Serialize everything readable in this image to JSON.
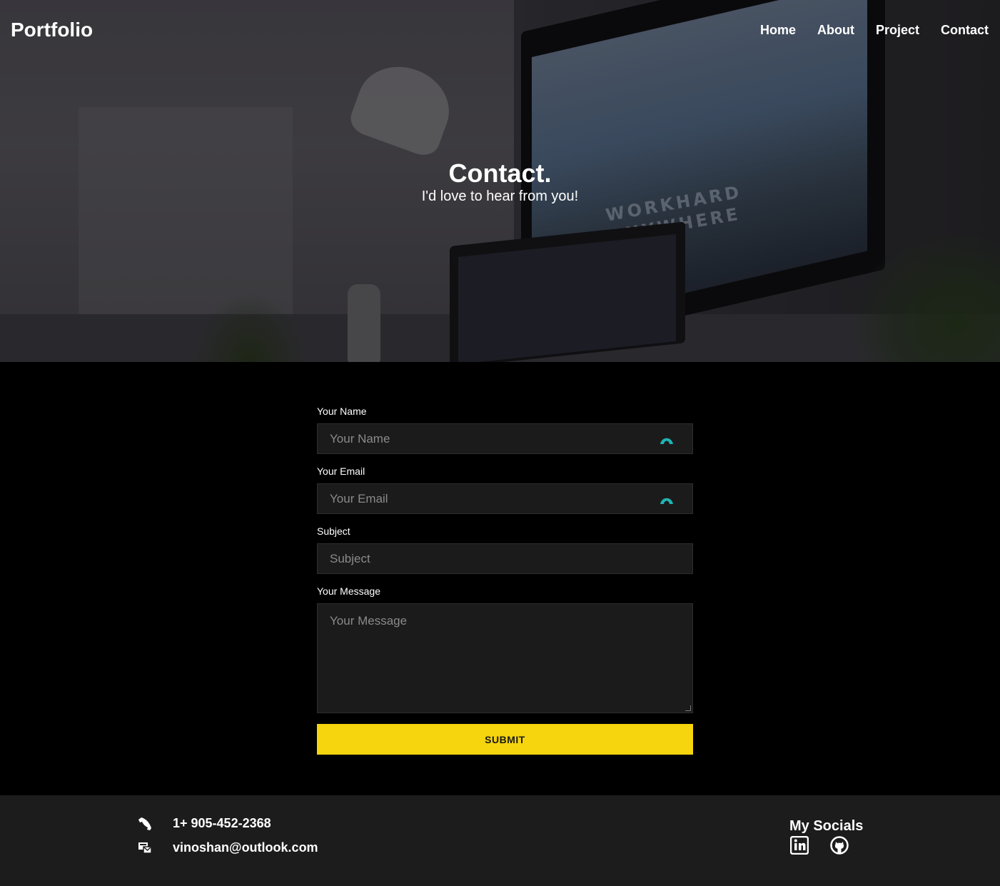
{
  "brand": {
    "logo": "Portfolio"
  },
  "nav": {
    "items": [
      "Home",
      "About",
      "Project",
      "Contact"
    ]
  },
  "hero": {
    "title": "Contact.",
    "subtitle": "I'd love to hear from you!",
    "screen_text_line1": "WORKHARD",
    "screen_text_line2": "ANYWHERE"
  },
  "form": {
    "name": {
      "label": "Your Name",
      "placeholder": "Your Name",
      "value": ""
    },
    "email": {
      "label": "Your Email",
      "placeholder": "Your Email",
      "value": ""
    },
    "subject": {
      "label": "Subject",
      "placeholder": "Subject",
      "value": ""
    },
    "message": {
      "label": "Your Message",
      "placeholder": "Your Message",
      "value": ""
    },
    "submit_label": "SUBMIT"
  },
  "footer": {
    "phone": "1+ 905-452-2368",
    "email": "vinoshan@outlook.com",
    "socials_title": "My Socials",
    "social_icons": [
      "linkedin-icon",
      "github-icon"
    ]
  },
  "colors": {
    "accent": "#f6d40e",
    "input_bg": "#1b1b1b",
    "footer_bg": "#1c1c1c",
    "password_manager_icon": "#1fb3b3"
  }
}
